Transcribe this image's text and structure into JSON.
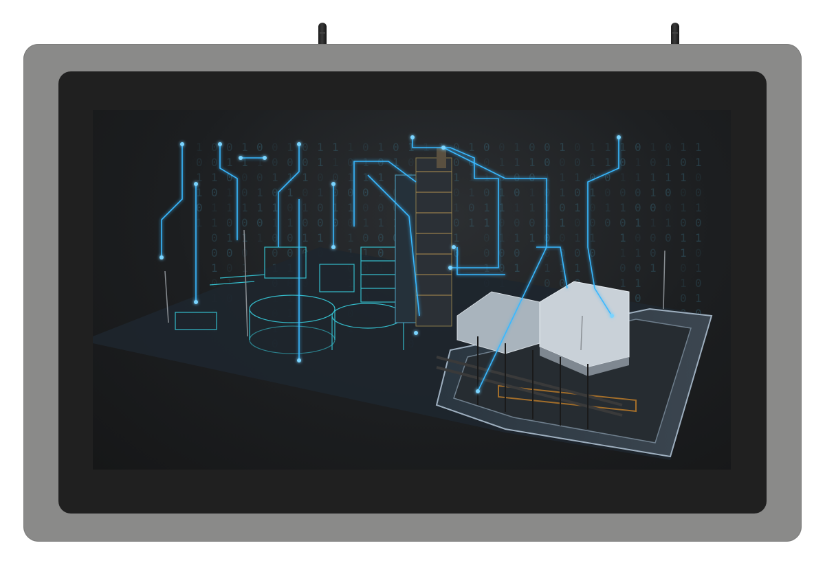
{
  "device": {
    "type": "industrial-panel-pc",
    "bezel_color": "#8a8a89",
    "glass_color": "#202020",
    "antenna_count": 2
  },
  "screen": {
    "scene": "industrial-plant-digital-twin",
    "accent_color": "#39b8ff",
    "binary_digits": [
      "1",
      "0",
      "1",
      "1",
      "0",
      "1",
      "0",
      "0",
      "1",
      "0",
      "1",
      "1",
      "0",
      "0",
      "1",
      "0",
      "1",
      "0",
      "1",
      "0"
    ]
  }
}
